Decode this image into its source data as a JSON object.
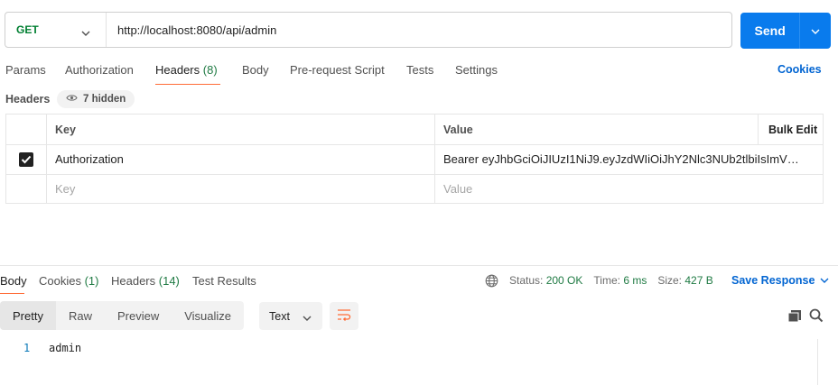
{
  "request": {
    "method": "GET",
    "url": "http://localhost:8080/api/admin",
    "send_label": "Send"
  },
  "request_tabs": [
    {
      "label": "Params",
      "count": ""
    },
    {
      "label": "Authorization",
      "count": ""
    },
    {
      "label": "Headers",
      "count": "(8)"
    },
    {
      "label": "Body",
      "count": ""
    },
    {
      "label": "Pre-request Script",
      "count": ""
    },
    {
      "label": "Tests",
      "count": ""
    },
    {
      "label": "Settings",
      "count": ""
    }
  ],
  "cookies_label": "Cookies",
  "headers_section": {
    "label": "Headers",
    "hidden_label": "7 hidden",
    "columns": {
      "key": "Key",
      "value": "Value",
      "bulk_edit": "Bulk Edit"
    },
    "rows": [
      {
        "checked": true,
        "key": "Authorization",
        "value": "Bearer eyJhbGciOiJIUzI1NiJ9.eyJzdWIiOiJhY2Nlc3NUb2tlbiIsImV4c..."
      }
    ],
    "placeholder": {
      "key": "Key",
      "value": "Value"
    }
  },
  "response_tabs": [
    {
      "label": "Body",
      "count": ""
    },
    {
      "label": "Cookies",
      "count": "(1)"
    },
    {
      "label": "Headers",
      "count": "(14)"
    },
    {
      "label": "Test Results",
      "count": ""
    }
  ],
  "response_meta": {
    "status_label": "Status:",
    "status_value": "200 OK",
    "time_label": "Time:",
    "time_value": "6 ms",
    "size_label": "Size:",
    "size_value": "427 B",
    "save_label": "Save Response"
  },
  "view_modes": [
    "Pretty",
    "Raw",
    "Preview",
    "Visualize"
  ],
  "format": "Text",
  "body_lines": [
    {
      "number": "1",
      "text": "admin"
    }
  ],
  "colors": {
    "accent": "#ff6c37",
    "send": "#097bed",
    "link": "#0265d2",
    "success": "#1f7a43",
    "method_get": "#007f31"
  },
  "icons": {
    "method_dropdown": "chevron-down-icon",
    "send_dropdown": "chevron-down-icon",
    "hidden": "eye-icon",
    "network": "globe-icon",
    "save_dropdown": "chevron-down-icon",
    "wrap": "wrap-lines-icon",
    "copy": "copy-icon",
    "search": "search-icon"
  }
}
